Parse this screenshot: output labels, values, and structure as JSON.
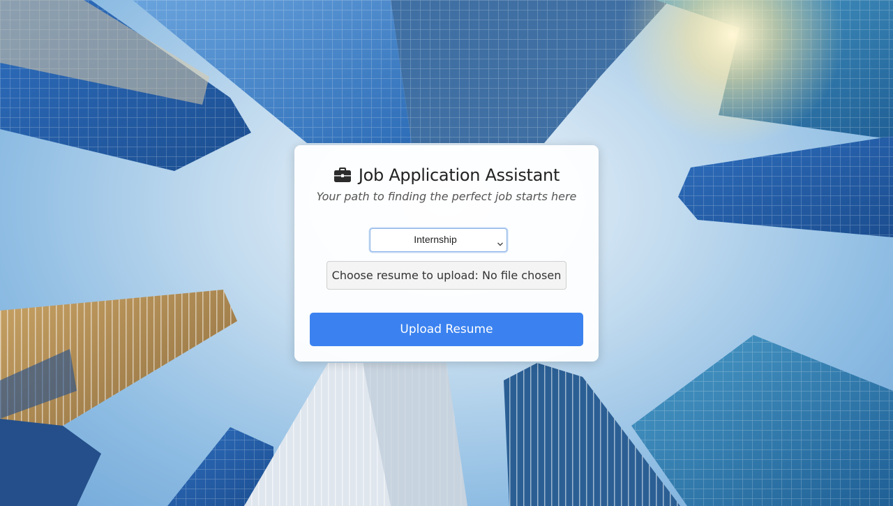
{
  "card": {
    "title": "Job Application Assistant",
    "subtitle": "Your path to finding the perfect job starts here"
  },
  "form": {
    "job_type_selected": "Internship",
    "file_input_label": "Choose resume to upload: No file chosen",
    "upload_button_label": "Upload Resume"
  },
  "icons": {
    "title_icon": "briefcase-icon",
    "select_icon": "chevron-down-icon"
  },
  "colors": {
    "accent": "#3b82f0",
    "card_background": "#ffffff",
    "title_text": "#222222",
    "subtitle_text": "#555555"
  }
}
